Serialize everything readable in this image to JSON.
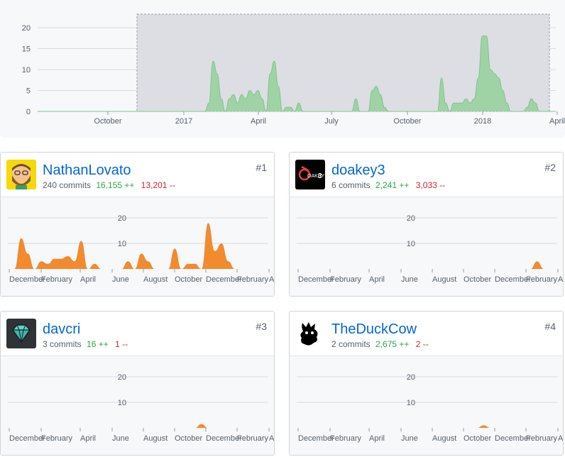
{
  "overview": {
    "y_ticks": [
      "0",
      "5",
      "10",
      "15",
      "20"
    ],
    "x_labels": [
      "October",
      "2017",
      "April",
      "July",
      "October",
      "2018",
      "April"
    ],
    "area_color": "#9fd3a6",
    "stroke_color": "#7fc48a",
    "selection_fill": "#dcdee3"
  },
  "contributors": [
    {
      "rank": "#1",
      "login": "NathanLovato",
      "commits": "240 commits",
      "additions": "16,155 ++",
      "deletions": "13,201 --",
      "avatar_icon": "bearded-man-avatar-icon",
      "chart_data": {
        "type": "area",
        "x": [
          "December",
          "February",
          "April",
          "June",
          "August",
          "October",
          "December",
          "February",
          "April"
        ],
        "yticks": [
          "20",
          "10"
        ],
        "ylim": [
          0,
          20
        ],
        "values": [
          0,
          0,
          12,
          6,
          0,
          3,
          2,
          4,
          4,
          5,
          3,
          11,
          0,
          2,
          0,
          0,
          0,
          0,
          3,
          0,
          6,
          3,
          0,
          0,
          0,
          8,
          0,
          2,
          2,
          0,
          18,
          7,
          10,
          3,
          0,
          0,
          0,
          0,
          0,
          0
        ],
        "color": "#f28a2e"
      }
    },
    {
      "rank": "#2",
      "login": "doakey3",
      "commits": "6 commits",
      "additions": "2,241 ++",
      "deletions": "3,033 --",
      "avatar_icon": "doakey3-logo-icon",
      "chart_data": {
        "type": "area",
        "x": [
          "December",
          "February",
          "April",
          "June",
          "August",
          "October",
          "December",
          "February",
          "April"
        ],
        "yticks": [
          "20",
          "10"
        ],
        "ylim": [
          0,
          20
        ],
        "values": [
          0,
          0,
          0,
          0,
          0,
          0,
          0,
          0,
          0,
          0,
          0,
          0,
          0,
          0,
          0,
          0,
          0,
          0,
          0,
          0,
          0,
          0,
          0,
          0,
          0,
          0,
          0,
          0,
          0,
          0,
          0,
          0,
          0,
          0,
          0,
          0,
          3,
          0,
          0,
          0
        ],
        "color": "#f28a2e"
      }
    },
    {
      "rank": "#3",
      "login": "davcri",
      "commits": "3 commits",
      "additions": "16 ++",
      "deletions": "1 --",
      "avatar_icon": "gem-icon",
      "chart_data": {
        "type": "area",
        "x": [
          "December",
          "February",
          "April",
          "June",
          "August",
          "October",
          "December",
          "February",
          "April"
        ],
        "yticks": [
          "20",
          "10"
        ],
        "ylim": [
          0,
          20
        ],
        "values": [
          0,
          0,
          0,
          0,
          0,
          0,
          0,
          0,
          0,
          0,
          0,
          0,
          0,
          0,
          0,
          0,
          0,
          0,
          0,
          0,
          0,
          0,
          0,
          0,
          0,
          0,
          0,
          0,
          0,
          1.5,
          0,
          0,
          0,
          0,
          0,
          0,
          0,
          0,
          0,
          0
        ],
        "color": "#f28a2e"
      }
    },
    {
      "rank": "#4",
      "login": "TheDuckCow",
      "commits": "2 commits",
      "additions": "2,675 ++",
      "deletions": "2 --",
      "avatar_icon": "duck-silhouette-icon",
      "chart_data": {
        "type": "area",
        "x": [
          "December",
          "February",
          "April",
          "June",
          "August",
          "October",
          "December",
          "February",
          "April"
        ],
        "yticks": [
          "20",
          "10"
        ],
        "ylim": [
          0,
          20
        ],
        "values": [
          0,
          0,
          0,
          0,
          0,
          0,
          0,
          0,
          0,
          0,
          0,
          0,
          0,
          0,
          0,
          0,
          0,
          0,
          0,
          0,
          0,
          0,
          0,
          0,
          0,
          0,
          0,
          0,
          1,
          0,
          0,
          0,
          0,
          0,
          0,
          0,
          0,
          0,
          0,
          0
        ],
        "color": "#f28a2e"
      }
    }
  ],
  "chart_data": {
    "type": "area",
    "title": "",
    "ylim": [
      0,
      20
    ],
    "yticks": [
      0,
      5,
      10,
      15,
      20
    ],
    "x": [
      "October",
      "2017",
      "April",
      "July",
      "October",
      "2018",
      "April"
    ],
    "values": [
      0,
      0,
      0,
      0,
      0,
      0,
      0,
      0,
      0,
      0,
      0,
      0,
      0,
      0,
      0,
      0,
      0,
      0,
      0,
      0,
      0,
      0,
      0,
      0,
      0,
      0,
      0,
      0,
      0,
      0,
      0,
      0,
      0,
      0,
      0,
      0,
      0,
      0,
      0,
      0,
      0,
      0,
      2,
      12,
      9,
      3,
      0,
      3,
      4,
      2,
      4,
      3,
      5,
      4,
      5,
      3,
      0,
      9,
      12,
      6,
      0,
      1,
      1,
      0,
      2,
      0,
      0,
      0,
      0,
      0,
      0,
      0,
      0,
      0,
      0,
      0,
      0,
      0,
      3,
      0,
      0,
      0,
      5,
      6,
      4,
      1,
      0,
      0,
      0,
      0,
      0,
      0,
      0,
      0,
      0,
      0,
      0,
      0,
      0,
      8,
      2,
      0,
      2,
      2,
      2,
      3,
      2,
      3,
      8,
      18,
      18,
      10,
      9,
      8,
      5,
      2,
      0,
      0,
      0,
      0,
      1,
      3,
      2,
      0,
      0,
      0,
      0,
      0
    ],
    "color": "#9fd3a6"
  }
}
